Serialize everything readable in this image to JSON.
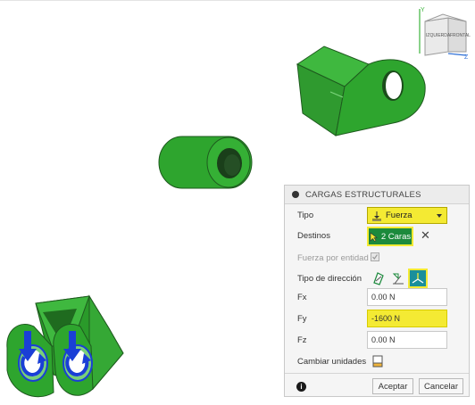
{
  "viewcube": {
    "left_face": "IZQUIERDA",
    "front_face": "FRONTAL",
    "axis_y": "Y",
    "axis_z": "Z"
  },
  "dialog": {
    "title": "CARGAS ESTRUCTURALES",
    "tipo": {
      "label": "Tipo",
      "value": "Fuerza"
    },
    "destinos": {
      "label": "Destinos",
      "button_text": "2 Caras"
    },
    "fuerza_por_entidad": {
      "label": "Fuerza por entidad",
      "checked": true
    },
    "tipo_direccion": {
      "label": "Tipo de dirección",
      "options": [
        "angle-vector-icon",
        "normal-icon",
        "xyz-vectors-icon"
      ],
      "selected": 2
    },
    "fx": {
      "label": "Fx",
      "value": "0.00 N"
    },
    "fy": {
      "label": "Fy",
      "value": "-1600 N"
    },
    "fz": {
      "label": "Fz",
      "value": "0.00 N"
    },
    "cambiar_unidades": {
      "label": "Cambiar unidades"
    },
    "accept": "Aceptar",
    "cancel": "Cancelar"
  },
  "colors": {
    "part_green": "#2ea52e",
    "highlight_yellow": "#f4ea33",
    "load_blue": "#1a3fd6"
  }
}
